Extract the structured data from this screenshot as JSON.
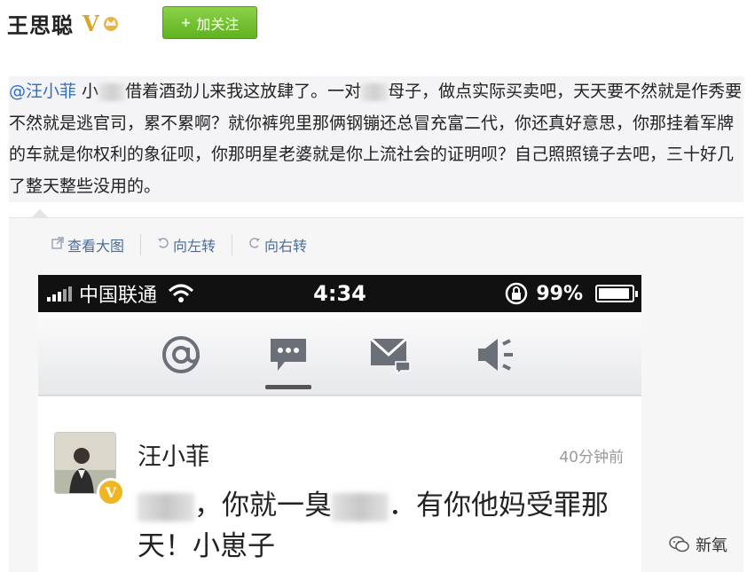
{
  "header": {
    "user_name": "王思聪",
    "verified_mark": "V",
    "follow_label": "加关注",
    "follow_plus": "+"
  },
  "post": {
    "mention": "@汪小菲",
    "text_parts": [
      " 小",
      "借着酒劲儿来我这放肆了。一对",
      "母子，做点实际买卖吧，天天要不然就是作秀要不然就是逃官司，累不累啊？就你裤兜里那俩钢镚还总冒充富二代，你还真好意思，你那挂着军牌的车就是你权利的象征呗，你那明星老婆就是你上流社会的证明呗？自己照照镜子去吧，三十好几了整天整些没用的。"
    ]
  },
  "toolbar": {
    "view_large": "查看大图",
    "rotate_left": "向左转",
    "rotate_right": "向右转"
  },
  "phone": {
    "carrier": "中国联通",
    "time": "4:34",
    "battery": "99%",
    "nav_icons": [
      "at-icon",
      "comment-icon",
      "mail-icon",
      "speaker-icon"
    ],
    "message": {
      "name": "汪小菲",
      "time": "40分钟前",
      "body_start": "",
      "body_mid": "，你就一臭",
      "body_end": "．有你他妈受罪那天！小崽子"
    }
  },
  "watermark": "新氧",
  "colors": {
    "mention": "#2e6fc3",
    "follow_green": "#6dbf2a",
    "verified_gold": "#f0b622",
    "tool_link": "#4a6d9a"
  }
}
